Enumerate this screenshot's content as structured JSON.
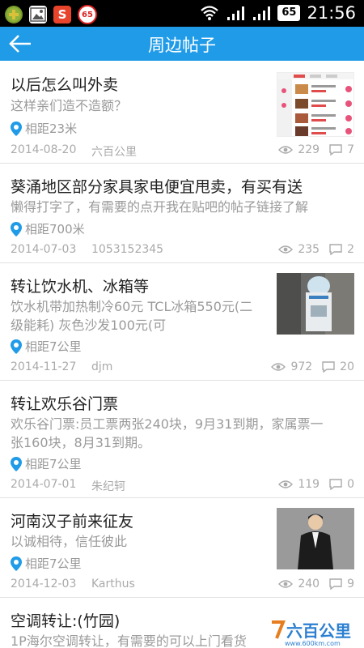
{
  "status_bar": {
    "badge_left": "65",
    "s_icon": "S",
    "battery": "65",
    "time": "21:56",
    "icons": [
      "app-icon",
      "gallery-icon",
      "s-app-icon",
      "badge-65-icon",
      "wifi-icon",
      "signal-icon",
      "signal-icon",
      "battery-icon"
    ]
  },
  "header": {
    "title": "周边帖子",
    "back_icon": "arrow-left-icon"
  },
  "posts": [
    {
      "title": "以后怎么叫外卖",
      "body": "这样亲们造不造额？",
      "location": "相距23米",
      "date": "2014-08-20",
      "author": "六百公里",
      "views": "229",
      "comments": "7",
      "has_image": true,
      "image": "menu-screenshot"
    },
    {
      "title": "葵涌地区部分家具家电便宜甩卖，有买有送",
      "body": "懒得打字了，有需要的点开我在贴吧的帖子链接了解",
      "location": "相距700米",
      "date": "2014-07-03",
      "author": "1053152345",
      "views": "235",
      "comments": "2",
      "has_image": false
    },
    {
      "title": "转让饮水机、冰箱等",
      "body_lines": [
        "饮水机带加热制冷60元  TCL冰箱550元(二",
        "级能耗)  灰色沙发100元(可"
      ],
      "location": "相距7公里",
      "date": "2014-11-27",
      "author": "djm",
      "views": "972",
      "comments": "20",
      "has_image": true,
      "image": "water-dispenser-photo"
    },
    {
      "title": "转让欢乐谷门票",
      "body_lines": [
        "欢乐谷门票:员工票两张240块，9月31到期，家属票一",
        "张160块，8月31到期。"
      ],
      "location": "相距7公里",
      "date": "2014-07-01",
      "author": "朱纪轲",
      "views": "119",
      "comments": "0",
      "has_image": false
    },
    {
      "title": "河南汉子前来征友",
      "body": "以诚相待，信任彼此",
      "location": "相距7公里",
      "date": "2014-12-03",
      "author": "Karthus",
      "views": "240",
      "comments": "9",
      "has_image": true,
      "image": "man-in-suit-photo"
    },
    {
      "title": "空调转让:(竹园)",
      "body": "1P海尔空调转让，有需要的可以上门看货",
      "has_image": false
    }
  ],
  "watermark": {
    "brand": "六百公里",
    "url": "www.600km.com"
  },
  "colors": {
    "header_bg": "#1f9be8",
    "title_text": "#222222",
    "meta_text": "#aaaaaa",
    "location_pin": "#1f9be8"
  }
}
